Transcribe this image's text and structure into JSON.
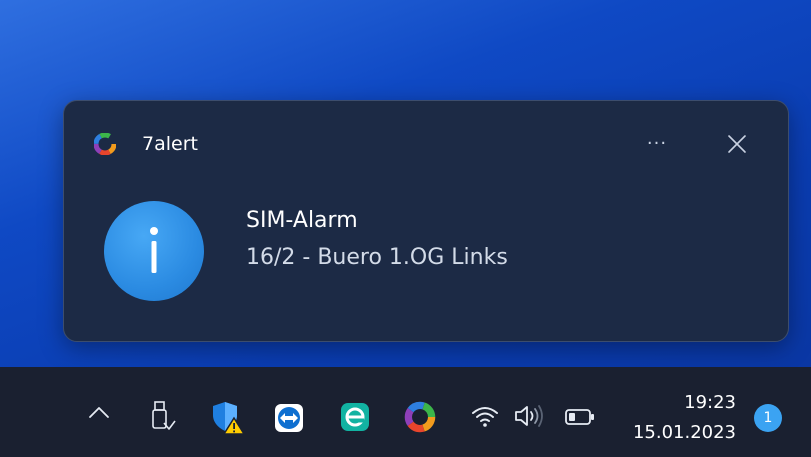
{
  "notification": {
    "app_name": "7alert",
    "more_label": "···",
    "title": "SIM-Alarm",
    "body": "16/2 - Buero 1.OG Links"
  },
  "taskbar": {
    "tray_icons": [
      "chevron-up-icon",
      "usb-drive-icon",
      "windows-security-warning-icon",
      "teamviewer-icon",
      "eset-icon",
      "7alert-icon",
      "wifi-icon",
      "speaker-icon",
      "battery-icon"
    ],
    "time": "19:23",
    "date": "15.01.2023",
    "notification_count": "1"
  },
  "colors": {
    "toast_background": "#1c2a45",
    "desktop_blue": "#0f49c4",
    "taskbar": "#1a2030",
    "accent": "#3ba3f2"
  }
}
